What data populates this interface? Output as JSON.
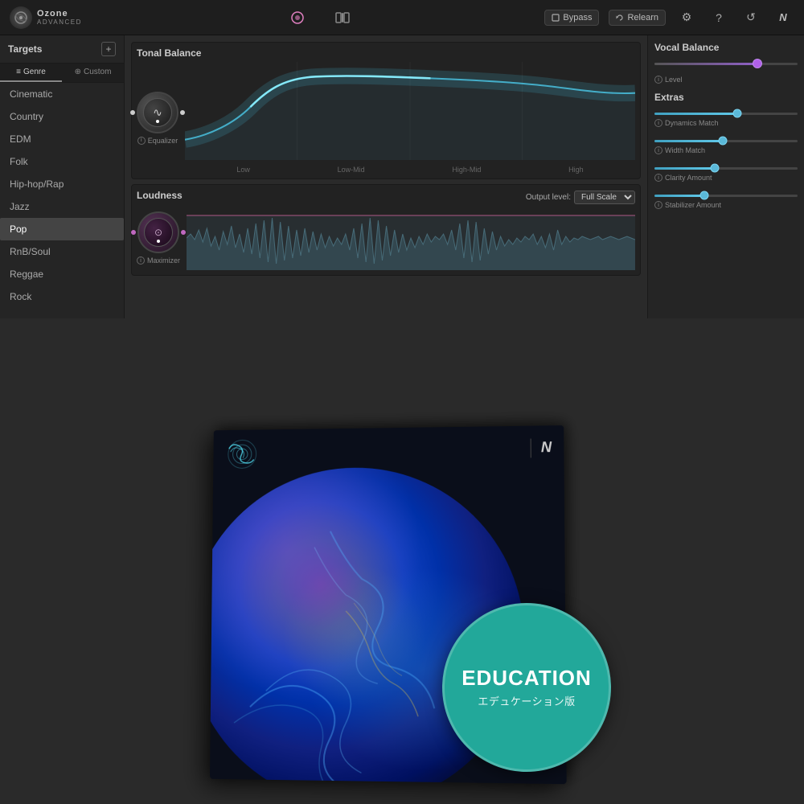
{
  "app": {
    "name": "Ozone",
    "subtitle": "ADVANCED",
    "bypass_label": "Bypass",
    "relearn_label": "Relearn"
  },
  "sidebar": {
    "title": "Targets",
    "add_label": "+",
    "tabs": [
      {
        "id": "genre",
        "label": "Genre",
        "icon": "≡"
      },
      {
        "id": "custom",
        "label": "Custom",
        "icon": "+"
      }
    ],
    "genres": [
      {
        "id": "cinematic",
        "label": "Cinematic",
        "active": false
      },
      {
        "id": "country",
        "label": "Country",
        "active": false
      },
      {
        "id": "edm",
        "label": "EDM",
        "active": false
      },
      {
        "id": "folk",
        "label": "Folk",
        "active": false
      },
      {
        "id": "hiphop",
        "label": "Hip-hop/Rap",
        "active": false
      },
      {
        "id": "jazz",
        "label": "Jazz",
        "active": false
      },
      {
        "id": "pop",
        "label": "Pop",
        "active": true
      },
      {
        "id": "rnb",
        "label": "RnB/Soul",
        "active": false
      },
      {
        "id": "reggae",
        "label": "Reggae",
        "active": false
      },
      {
        "id": "rock",
        "label": "Rock",
        "active": false
      }
    ]
  },
  "tonal_balance": {
    "title": "Tonal Balance",
    "knob_label": "Equalizer",
    "axis": [
      "Low",
      "Low-Mid",
      "High-Mid",
      "High"
    ]
  },
  "loudness": {
    "title": "Loudness",
    "output_label": "Output level:",
    "output_value": "Full Scale",
    "knob_label": "Maximizer"
  },
  "vocal_balance": {
    "title": "Vocal Balance",
    "level_label": "Level"
  },
  "extras": {
    "title": "Extras",
    "sliders": [
      {
        "id": "dynamics",
        "label": "Dynamics Match",
        "fill": 58
      },
      {
        "id": "width",
        "label": "Width Match",
        "fill": 48
      },
      {
        "id": "clarity",
        "label": "Clarity Amount",
        "fill": 42
      },
      {
        "id": "stabilizer",
        "label": "Stabilizer Amount",
        "fill": 35
      }
    ]
  },
  "product": {
    "badge_en": "EDUCATION",
    "badge_jp": "エデュケーション版"
  }
}
